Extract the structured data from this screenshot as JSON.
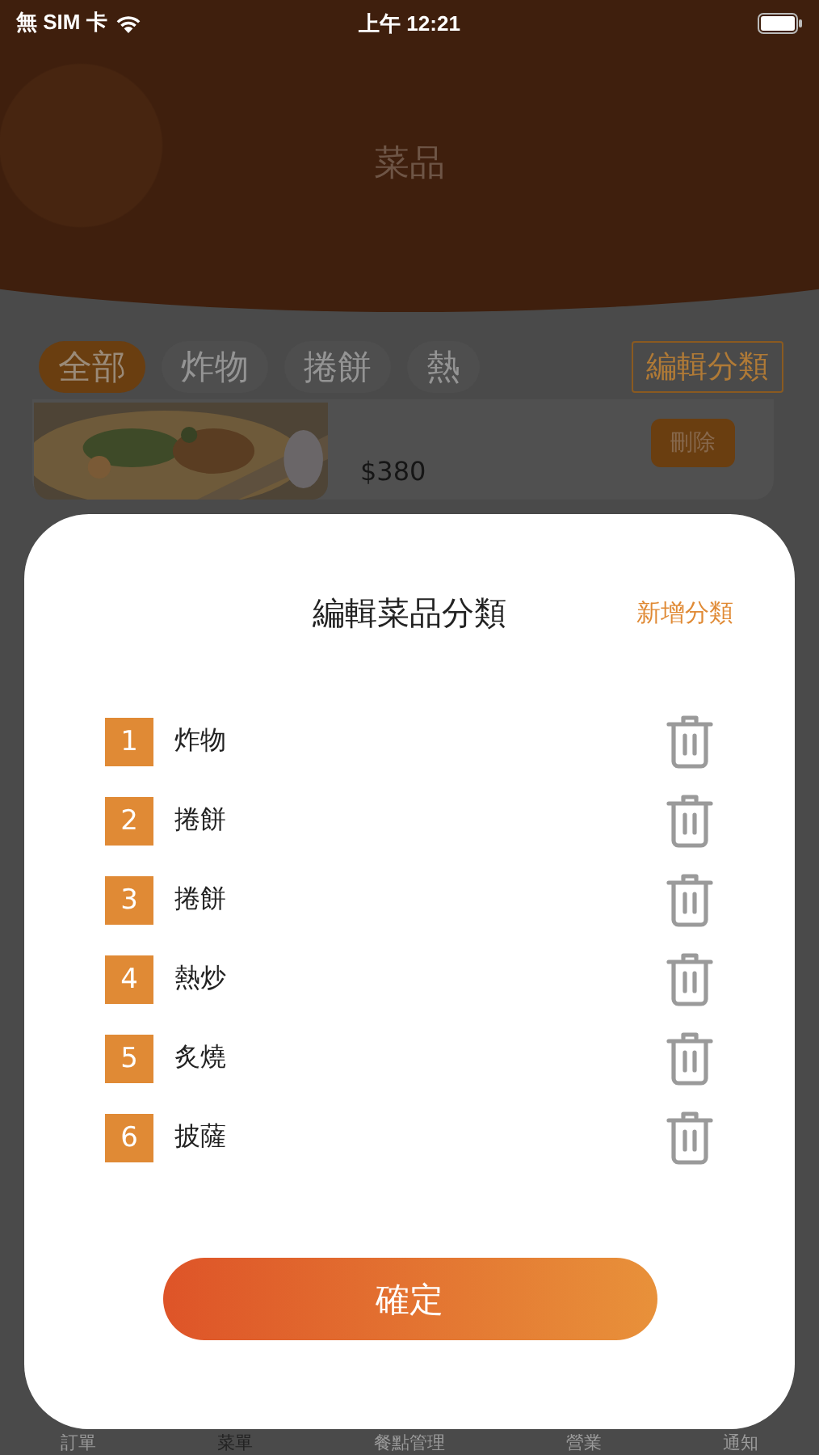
{
  "status_bar": {
    "carrier": "無 SIM 卡",
    "time": "上午 12:21"
  },
  "header": {
    "title": "菜品"
  },
  "category_tabs": [
    {
      "label": "全部",
      "selected": true
    },
    {
      "label": "炸物",
      "selected": false
    },
    {
      "label": "捲餅",
      "selected": false
    },
    {
      "label": "熱",
      "selected": false
    }
  ],
  "edit_categories_button": "編輯分類",
  "dish_card": {
    "price": "$380",
    "delete_button": "刪除"
  },
  "bottom_tabs": [
    {
      "label": "訂單",
      "selected": false
    },
    {
      "label": "菜單",
      "selected": true
    },
    {
      "label": "餐點管理",
      "selected": false
    },
    {
      "label": "營業",
      "selected": false
    },
    {
      "label": "通知",
      "selected": false
    }
  ],
  "dialog": {
    "title": "編輯菜品分類",
    "add_button": "新增分類",
    "categories": [
      {
        "number": "1",
        "name": "炸物"
      },
      {
        "number": "2",
        "name": "捲餅"
      },
      {
        "number": "3",
        "name": "捲餅"
      },
      {
        "number": "4",
        "name": "熱炒"
      },
      {
        "number": "5",
        "name": "炙燒"
      },
      {
        "number": "6",
        "name": "披薩"
      }
    ],
    "confirm_button": "確定"
  }
}
